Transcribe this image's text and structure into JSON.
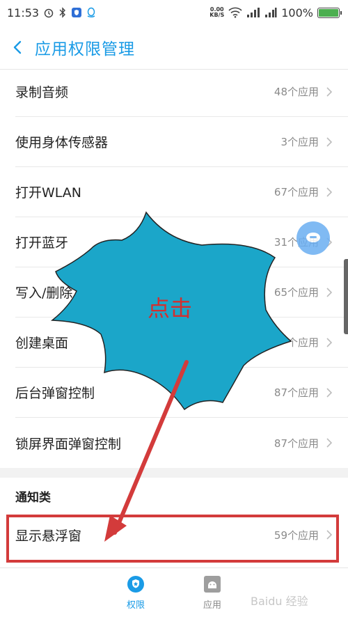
{
  "status_bar": {
    "time": "11:53",
    "net_speed_value": "0.00",
    "net_speed_unit": "KB/S",
    "battery_percent": "100%"
  },
  "header": {
    "title": "应用权限管理"
  },
  "permissions": [
    {
      "label": "录制音频",
      "count": "48个应用"
    },
    {
      "label": "使用身体传感器",
      "count": "3个应用"
    },
    {
      "label": "打开WLAN",
      "count": "67个应用"
    },
    {
      "label": "打开蓝牙",
      "count": "31个应用"
    },
    {
      "label": "写入/删除",
      "count": "65个应用"
    },
    {
      "label": "创建桌面",
      "count": "个应用"
    },
    {
      "label": "后台弹窗控制",
      "count": "87个应用"
    },
    {
      "label": "锁屏界面弹窗控制",
      "count": "87个应用"
    }
  ],
  "notification_section": {
    "title": "通知类",
    "items": [
      {
        "label": "显示悬浮窗",
        "count": "59个应用"
      }
    ]
  },
  "bottom_nav": {
    "permissions_label": "权限",
    "apps_label": "应用"
  },
  "annotation": {
    "text": "点击"
  },
  "watermark": "Baidu 经验",
  "colors": {
    "accent": "#1a9be6",
    "burst_fill": "#1ba6c9",
    "annotation_red": "#d33b3b"
  }
}
